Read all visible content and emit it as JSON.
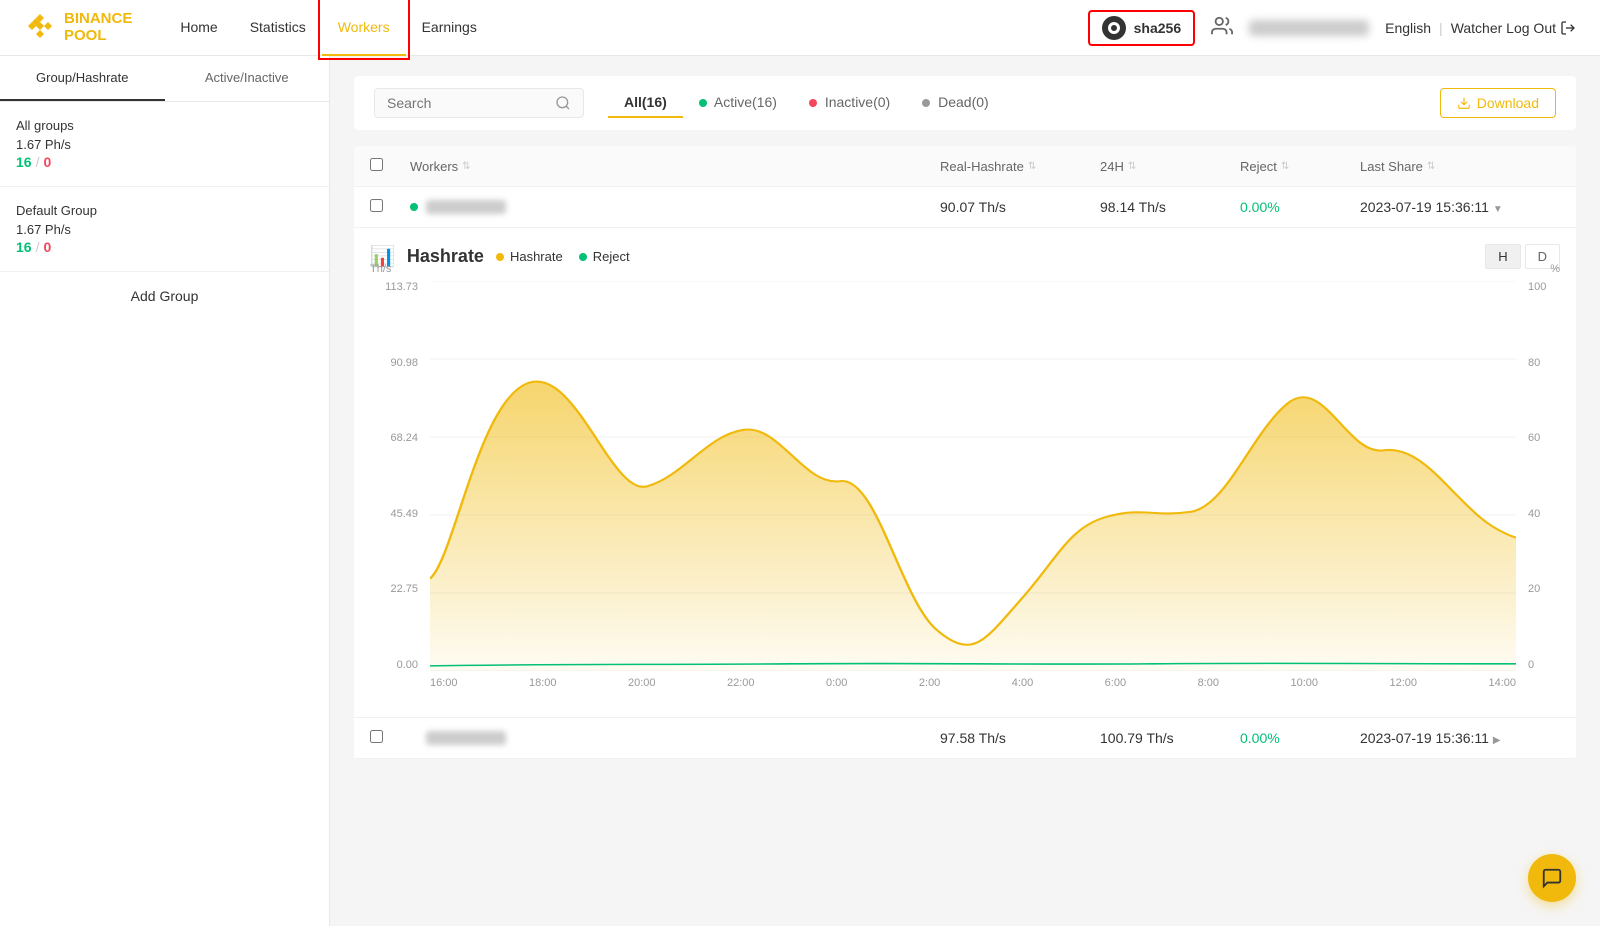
{
  "logo": {
    "line1": "BINANCE",
    "line2": "POOL"
  },
  "nav": {
    "items": [
      {
        "id": "home",
        "label": "Home",
        "active": false
      },
      {
        "id": "statistics",
        "label": "Statistics",
        "active": false
      },
      {
        "id": "workers",
        "label": "Workers",
        "active": true
      },
      {
        "id": "earnings",
        "label": "Earnings",
        "active": false
      }
    ]
  },
  "header": {
    "algo": "sha256",
    "language": "English",
    "logout_label": "Watcher Log Out"
  },
  "sidebar": {
    "tab1": "Group/Hashrate",
    "tab2": "Active/Inactive",
    "groups": [
      {
        "name": "All groups",
        "hashrate": "1.67 Ph/s",
        "active": "16",
        "inactive": "0"
      },
      {
        "name": "Default Group",
        "hashrate": "1.67 Ph/s",
        "active": "16",
        "inactive": "0"
      }
    ],
    "add_group": "Add Group"
  },
  "filter": {
    "search_placeholder": "Search",
    "tabs": [
      {
        "label": "All(16)",
        "active": true
      },
      {
        "label": "Active(16)",
        "active": false,
        "dot": "green"
      },
      {
        "label": "Inactive(0)",
        "active": false,
        "dot": "red"
      },
      {
        "label": "Dead(0)",
        "active": false,
        "dot": "gray"
      }
    ],
    "download": "Download"
  },
  "table": {
    "columns": [
      "Workers",
      "Real-Hashrate",
      "24H",
      "Reject",
      "Last Share"
    ],
    "row1": {
      "hashrate": "90.07 Th/s",
      "h24": "98.14 Th/s",
      "reject": "0.00%",
      "last_share": "2023-07-19 15:36:11"
    },
    "row2": {
      "hashrate": "97.58 Th/s",
      "h24": "100.79 Th/s",
      "reject": "0.00%",
      "last_share": "2023-07-19 15:36:11"
    }
  },
  "chart": {
    "title": "Hashrate",
    "legend_hashrate": "Hashrate",
    "legend_reject": "Reject",
    "y_unit_left": "Th/s",
    "y_unit_right": "%",
    "y_labels_left": [
      "113.73",
      "90.98",
      "68.24",
      "45.49",
      "22.75",
      "0.00"
    ],
    "y_labels_right": [
      "100",
      "80",
      "60",
      "40",
      "20",
      "0"
    ],
    "x_labels": [
      "16:00",
      "18:00",
      "20:00",
      "22:00",
      "0:00",
      "2:00",
      "4:00",
      "6:00",
      "8:00",
      "10:00",
      "12:00",
      "14:00"
    ],
    "time_buttons": [
      "H",
      "D"
    ],
    "active_time": "H"
  },
  "colors": {
    "brand": "#F0B90B",
    "active_workers": "#02C076",
    "inactive_workers": "#F6465D",
    "hashrate_line": "#F0B90B",
    "reject_line": "#02C076"
  }
}
